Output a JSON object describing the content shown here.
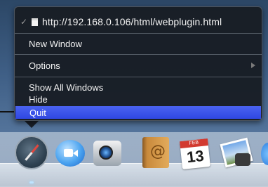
{
  "menu": {
    "current_window": {
      "checked": true,
      "check_glyph": "✓",
      "icon": "page-icon",
      "url": "http://192.168.0.106/html/webplugin.html"
    },
    "items": {
      "new_window": "New Window",
      "options": "Options",
      "show_all_windows": "Show All Windows",
      "hide": "Hide",
      "quit": "Quit"
    },
    "highlighted_item": "Quit",
    "highlight_color": "#3a53ea"
  },
  "dock": {
    "icons": [
      "safari-icon",
      "facetime-icon",
      "photo-booth-icon",
      "address-book-icon",
      "calendar-icon",
      "iphoto-icon"
    ],
    "calendar": {
      "month": "FEB",
      "day": "13"
    }
  }
}
